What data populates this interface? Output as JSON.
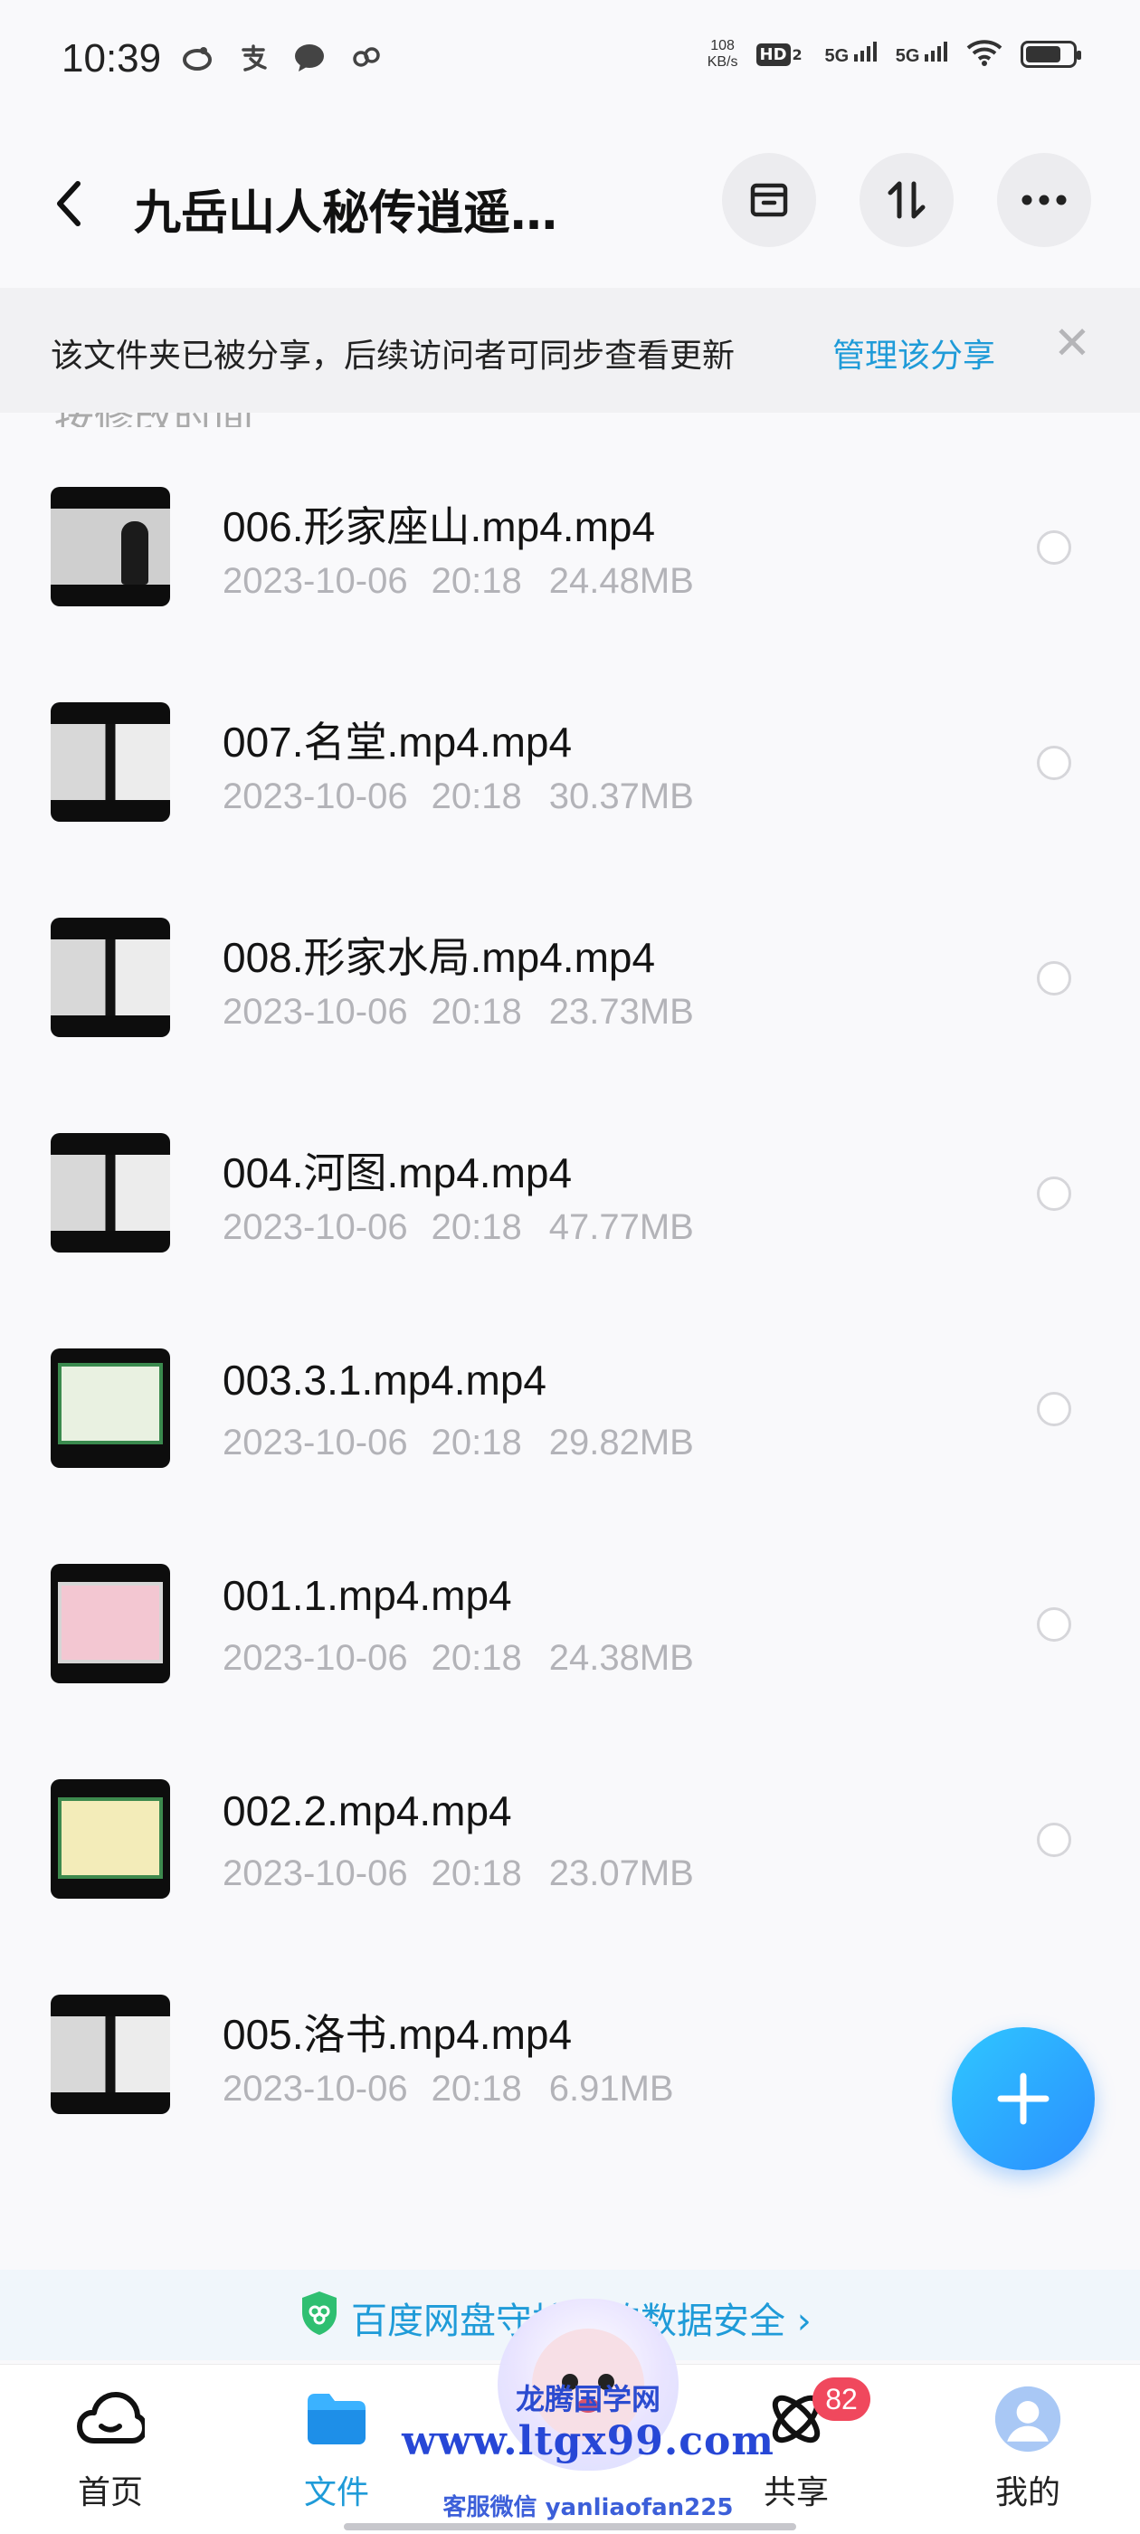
{
  "status_bar": {
    "time": "10:39",
    "net_speed_value": "108",
    "net_speed_unit": "KB/s",
    "hd_label": "HD",
    "hd_sub": "2",
    "signal1": "5G",
    "signal2": "5G",
    "battery_level": 0.75,
    "app_icons": [
      "weibo-icon",
      "alipay-icon",
      "chat-bubble-icon",
      "link-icon"
    ]
  },
  "header": {
    "title": "九岳山人秘传逍遥…",
    "actions": [
      "archive-icon",
      "sort-icon",
      "more-icon"
    ]
  },
  "share_banner": {
    "text": "该文件夹已被分享，后续访问者可同步查看更新",
    "link": "管理该分享",
    "close": "✕"
  },
  "sort_peek": "按修改时间",
  "files": [
    {
      "name": "006.形家座山.mp4.mp4",
      "date": "2023-10-06",
      "time": "20:18",
      "size": "24.48MB",
      "thumb": "person"
    },
    {
      "name": "007.名堂.mp4.mp4",
      "date": "2023-10-06",
      "time": "20:18",
      "size": "30.37MB",
      "thumb": "doc"
    },
    {
      "name": "008.形家水局.mp4.mp4",
      "date": "2023-10-06",
      "time": "20:18",
      "size": "23.73MB",
      "thumb": "doc"
    },
    {
      "name": "004.河图.mp4.mp4",
      "date": "2023-10-06",
      "time": "20:18",
      "size": "47.77MB",
      "thumb": "doc"
    },
    {
      "name": "003.3.1.mp4.mp4",
      "date": "2023-10-06",
      "time": "20:18",
      "size": "29.82MB",
      "thumb": "screen-green"
    },
    {
      "name": "001.1.mp4.mp4",
      "date": "2023-10-06",
      "time": "20:18",
      "size": "24.38MB",
      "thumb": "screen-pink"
    },
    {
      "name": "002.2.mp4.mp4",
      "date": "2023-10-06",
      "time": "20:18",
      "size": "23.07MB",
      "thumb": "screen-yellow"
    },
    {
      "name": "005.洛书.mp4.mp4",
      "date": "2023-10-06",
      "time": "20:18",
      "size": "6.91MB",
      "thumb": "doc"
    }
  ],
  "fab": {
    "icon": "plus-icon"
  },
  "security_promo": {
    "text": "百度网盘守护你的数据安全",
    "chevron": "›"
  },
  "bottom_nav": {
    "items": [
      {
        "label": "首页",
        "icon": "cloud-home-icon",
        "active": false
      },
      {
        "label": "文件",
        "icon": "folder-icon",
        "active": true
      },
      {
        "label": "",
        "icon": "center-icon",
        "active": false
      },
      {
        "label": "共享",
        "icon": "share-atom-icon",
        "active": false,
        "badge": "82"
      },
      {
        "label": "我的",
        "icon": "avatar-icon",
        "active": false
      }
    ]
  },
  "watermark": {
    "line1": "龙腾国学网",
    "line2": "www.ltgx99.com",
    "line3": "客服微信 yanliaofan225"
  },
  "colors": {
    "accent": "#1f9bd8",
    "badge": "#f0485d",
    "fab_start": "#2fc7ff",
    "fab_end": "#2a8dff"
  }
}
